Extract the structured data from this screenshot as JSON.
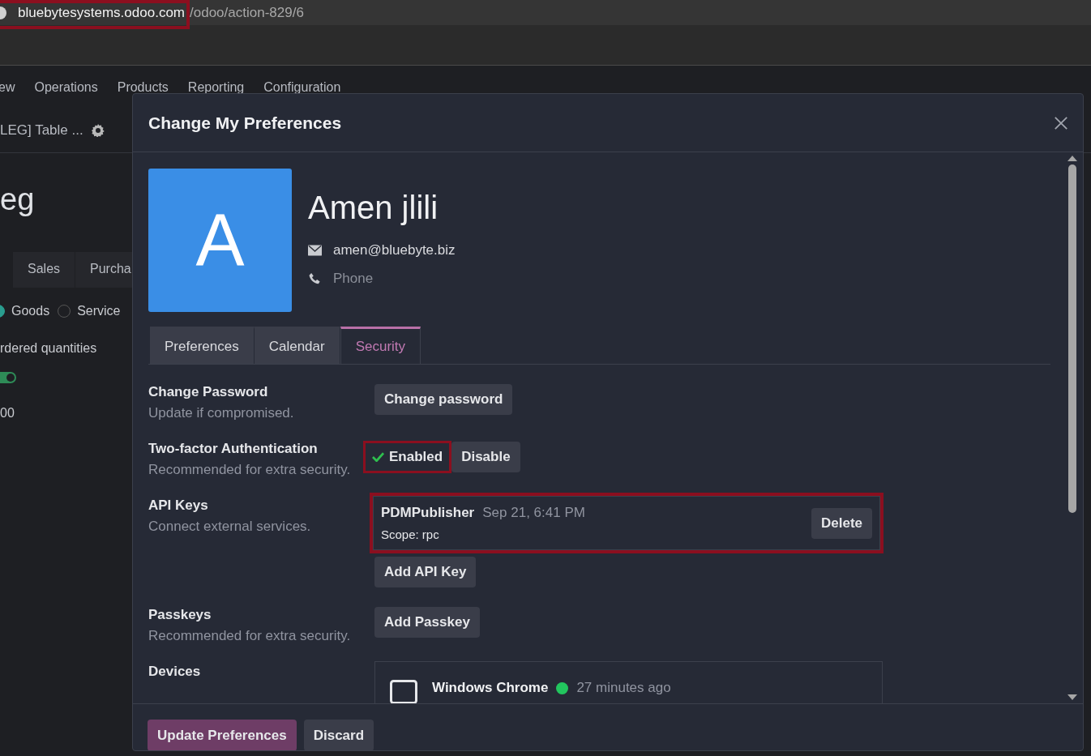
{
  "browser": {
    "url_domain": "bluebytesystems.odoo.com",
    "url_path": "/odoo/action-829/6",
    "domain_highlighted": true
  },
  "menu": [
    "ew",
    "Operations",
    "Products",
    "Reporting",
    "Configuration"
  ],
  "breadcrumb": "LEG] Table ...",
  "record": {
    "title": "eg",
    "tabs": [
      {
        "label": "Sales",
        "selected": false
      },
      {
        "label": "Purcha",
        "selected": false
      }
    ],
    "product_type": [
      {
        "label": "Goods",
        "selected": true
      },
      {
        "label": "Service",
        "selected": false
      }
    ],
    "invoice_policy": "rdered quantities",
    "toggle": {
      "on": true
    },
    "price": "00"
  },
  "dialog": {
    "title": "Change My Preferences",
    "user": {
      "initial": "A",
      "name": "Amen jlili",
      "email": "amen@bluebyte.biz",
      "phone_placeholder": "Phone"
    },
    "tabs": [
      {
        "label": "Preferences",
        "selected": false
      },
      {
        "label": "Calendar",
        "selected": false
      },
      {
        "label": "Security",
        "selected": true
      }
    ],
    "sections": [
      {
        "kind": "button",
        "title": "Change Password",
        "description": "Update if compromised.",
        "button": "Change password"
      },
      {
        "kind": "twofa",
        "title": "Two-factor Authentication",
        "description": "Recommended for extra security.",
        "status": "Enabled",
        "enabled": true,
        "highlighted": true,
        "button": "Disable"
      },
      {
        "kind": "apikeys",
        "title": "API Keys",
        "description": "Connect external services.",
        "keys": [
          {
            "name": "PDMPublisher",
            "date": "Sep 21, 6:41 PM",
            "scope": "Scope: rpc",
            "button": "Delete",
            "highlighted": true
          }
        ],
        "button": "Add API Key"
      },
      {
        "kind": "button",
        "title": "Passkeys",
        "description": "Recommended for extra security.",
        "button": "Add Passkey"
      },
      {
        "kind": "devices",
        "title": "Devices",
        "devices": [
          {
            "name": "Windows Chrome",
            "active": true,
            "last_seen": "27 minutes ago"
          }
        ]
      }
    ],
    "footer_buttons": [
      {
        "label": "Update Preferences",
        "primary": true
      },
      {
        "label": "Discard",
        "primary": false
      }
    ]
  }
}
